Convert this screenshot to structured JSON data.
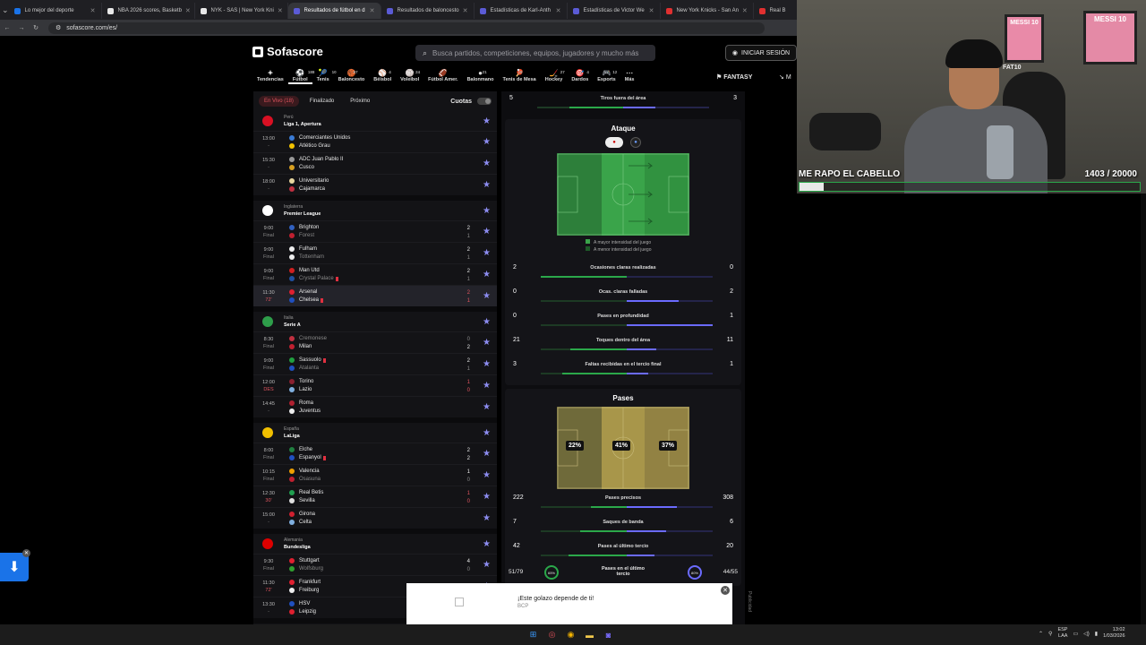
{
  "browser": {
    "tabs": [
      {
        "title": "Lo mejor del deporte",
        "color": "#1a73e8",
        "active": false
      },
      {
        "title": "NBA 2026 scores, Basketb",
        "color": "#e8e8e8",
        "active": false
      },
      {
        "title": "NYK - SAS | New York Kni",
        "color": "#e8e8e8",
        "active": false
      },
      {
        "title": "Resultados de fútbol en d",
        "color": "#5b5bd6",
        "active": true
      },
      {
        "title": "Resultados de baloncesto",
        "color": "#5b5bd6",
        "active": false
      },
      {
        "title": "Estadísticas de Karl-Anth",
        "color": "#5b5bd6",
        "active": false
      },
      {
        "title": "Estadísticas de Victor We",
        "color": "#5b5bd6",
        "active": false
      },
      {
        "title": "New York Knicks - San An",
        "color": "#e03030",
        "active": false
      },
      {
        "title": "Real B",
        "color": "#e03030",
        "active": false
      }
    ],
    "url": "sofascore.com/es/"
  },
  "header": {
    "logo": "Sofascore",
    "search_placeholder": "Busca partidos, competiciones, equipos, jugadores y mucho más",
    "login": "INICIAR SESIÓN",
    "fantasy": "FANTASY",
    "more_cut": "M"
  },
  "sports": [
    {
      "label": "Tendencias",
      "count": "",
      "icon": "✦",
      "active": false
    },
    {
      "label": "Fútbol",
      "count": "188",
      "icon": "⚽",
      "active": true
    },
    {
      "label": "Tenis",
      "count": "10",
      "icon": "🎾",
      "active": false
    },
    {
      "label": "Baloncesto",
      "count": "57",
      "icon": "🏀",
      "active": false
    },
    {
      "label": "Béisbol",
      "count": "4",
      "icon": "⚾",
      "active": false
    },
    {
      "label": "Voleibol",
      "count": "24",
      "icon": "🏐",
      "active": false
    },
    {
      "label": "Fútbol Amer.",
      "count": "",
      "icon": "🏈",
      "active": false
    },
    {
      "label": "Balonmano",
      "count": "21",
      "icon": "●",
      "active": false
    },
    {
      "label": "Tenis de Mesa",
      "count": "18",
      "icon": "🏓",
      "active": false
    },
    {
      "label": "Hockey",
      "count": "27",
      "icon": "🏒",
      "active": false
    },
    {
      "label": "Dardos",
      "count": "4",
      "icon": "🎯",
      "active": false
    },
    {
      "label": "Esports",
      "count": "12",
      "icon": "🎮",
      "active": false
    },
    {
      "label": "Más",
      "count": "",
      "icon": "⋯",
      "active": false
    }
  ],
  "filters": {
    "live": "En Vivo (18)",
    "finished": "Finalizado",
    "upcoming": "Próximo",
    "odds": "Cuotas"
  },
  "leagues": [
    {
      "country": "Perú",
      "name": "Liga 1, Apertura",
      "flag": "#d91023",
      "matches": [
        {
          "time": "13:00",
          "status": "-",
          "home": "Comerciantes Unidos",
          "away": "Atlético Grau",
          "hs": "",
          "as": "",
          "hc": "#3a7bd5",
          "ac": "#f2c200",
          "win": "",
          "sel": false,
          "live": false
        },
        {
          "time": "15:30",
          "status": "-",
          "home": "ADC Juan Pablo II",
          "away": "Cusco",
          "hs": "",
          "as": "",
          "hc": "#999",
          "ac": "#d8a020",
          "win": "",
          "sel": false,
          "live": false
        },
        {
          "time": "18:00",
          "status": "-",
          "home": "Universitario",
          "away": "Cajamarca",
          "hs": "",
          "as": "",
          "hc": "#e8d7a0",
          "ac": "#c03040",
          "win": "",
          "sel": false,
          "live": false
        }
      ]
    },
    {
      "country": "Inglaterra",
      "name": "Premier League",
      "flag": "#ffffff",
      "matches": [
        {
          "time": "9:00",
          "status": "Final",
          "home": "Brighton",
          "away": "Forest",
          "hs": "2",
          "as": "1",
          "hc": "#3060c0",
          "ac": "#c02030",
          "win": "home",
          "sel": false,
          "live": false
        },
        {
          "time": "9:00",
          "status": "Final",
          "home": "Fulham",
          "away": "Tottenham",
          "hs": "2",
          "as": "1",
          "hc": "#eee",
          "ac": "#eee",
          "win": "home",
          "sel": false,
          "live": false
        },
        {
          "time": "9:00",
          "status": "Final",
          "home": "Man Utd",
          "away": "Crystal Palace",
          "hs": "2",
          "as": "1",
          "hc": "#d02020",
          "ac": "#2050a0",
          "win": "home",
          "sel": false,
          "live": false,
          "away_red": true
        },
        {
          "time": "11:30",
          "status": "72'",
          "home": "Arsenal",
          "away": "Chelsea",
          "hs": "2",
          "as": "1",
          "hc": "#e02030",
          "ac": "#2050c0",
          "win": "",
          "sel": true,
          "live": true,
          "away_red": true
        }
      ]
    },
    {
      "country": "Italia",
      "name": "Serie A",
      "flag": "#2e9e4a",
      "matches": [
        {
          "time": "8:30",
          "status": "Final",
          "home": "Cremonese",
          "away": "Milan",
          "hs": "0",
          "as": "2",
          "hc": "#c03040",
          "ac": "#c02030",
          "win": "away",
          "sel": false,
          "live": false
        },
        {
          "time": "9:00",
          "status": "Final",
          "home": "Sassuolo",
          "away": "Atalanta",
          "hs": "2",
          "as": "1",
          "hc": "#20a040",
          "ac": "#2050c0",
          "win": "home",
          "sel": false,
          "live": false,
          "home_red": true
        },
        {
          "time": "12:00",
          "status": "DES",
          "home": "Torino",
          "away": "Lazio",
          "hs": "1",
          "as": "0",
          "hc": "#8a2030",
          "ac": "#80b0e0",
          "win": "",
          "sel": false,
          "live": true
        },
        {
          "time": "14:45",
          "status": "-",
          "home": "Roma",
          "away": "Juventus",
          "hs": "",
          "as": "",
          "hc": "#b02030",
          "ac": "#eee",
          "win": "",
          "sel": false,
          "live": false
        }
      ]
    },
    {
      "country": "España",
      "name": "LaLiga",
      "flag": "#f1bf00",
      "matches": [
        {
          "time": "8:00",
          "status": "Final",
          "home": "Elche",
          "away": "Espanyol",
          "hs": "2",
          "as": "2",
          "hc": "#208040",
          "ac": "#2050c0",
          "win": "",
          "sel": false,
          "live": false,
          "away_red": true
        },
        {
          "time": "10:15",
          "status": "Final",
          "home": "Valencia",
          "away": "Osasuna",
          "hs": "1",
          "as": "0",
          "hc": "#f0a000",
          "ac": "#c02030",
          "win": "home",
          "sel": false,
          "live": false
        },
        {
          "time": "12:30",
          "status": "30'",
          "home": "Real Betis",
          "away": "Sevilla",
          "hs": "1",
          "as": "0",
          "hc": "#20a050",
          "ac": "#e0e0e0",
          "win": "",
          "sel": false,
          "live": true
        },
        {
          "time": "15:00",
          "status": "-",
          "home": "Girona",
          "away": "Celta",
          "hs": "",
          "as": "",
          "hc": "#d02030",
          "ac": "#80b0e0",
          "win": "",
          "sel": false,
          "live": false
        }
      ]
    },
    {
      "country": "Alemania",
      "name": "Bundesliga",
      "flag": "#dd0000",
      "matches": [
        {
          "time": "9:30",
          "status": "Final",
          "home": "Stuttgart",
          "away": "Wolfsburg",
          "hs": "4",
          "as": "0",
          "hc": "#e02030",
          "ac": "#30a030",
          "win": "home",
          "sel": false,
          "live": false
        },
        {
          "time": "11:30",
          "status": "72'",
          "home": "Frankfurt",
          "away": "Freiburg",
          "hs": "",
          "as": "",
          "hc": "#e02030",
          "ac": "#eee",
          "win": "",
          "sel": false,
          "live": true
        },
        {
          "time": "13:30",
          "status": "-",
          "home": "HSV",
          "away": "Leipzig",
          "hs": "",
          "as": "",
          "hc": "#2050c0",
          "ac": "#e02030",
          "win": "",
          "sel": false,
          "live": false
        }
      ]
    }
  ],
  "stats_top": [
    {
      "label": "Tiros fuera del área",
      "home": "5",
      "away": "3",
      "h": 0.62,
      "a": 0.38
    }
  ],
  "attack": {
    "title": "Ataque",
    "legend_high": "A mayor intensidad del juego",
    "legend_low": "A menor intensidad del juego",
    "stats": [
      {
        "label": "Ocasiones claras realizadas",
        "home": "2",
        "away": "0",
        "h": 1.0,
        "a": 0.0
      },
      {
        "label": "Ocas. claras falladas",
        "home": "0",
        "away": "2",
        "h": 0.0,
        "a": 0.6
      },
      {
        "label": "Pases en profundidad",
        "home": "0",
        "away": "1",
        "h": 0.0,
        "a": 1.0
      },
      {
        "label": "Toques dentro del área",
        "home": "21",
        "away": "11",
        "h": 0.66,
        "a": 0.34
      },
      {
        "label": "Faltas recibidas en el tercio final",
        "home": "3",
        "away": "1",
        "h": 0.75,
        "a": 0.25
      }
    ]
  },
  "passes": {
    "title": "Pases",
    "zones": [
      "22%",
      "41%",
      "37%"
    ],
    "stats": [
      {
        "label": "Pases precisos",
        "home": "222",
        "away": "308",
        "h": 0.42,
        "a": 0.58
      },
      {
        "label": "Saques de banda",
        "home": "7",
        "away": "6",
        "h": 0.54,
        "a": 0.46
      },
      {
        "label": "Pases al último tercio",
        "home": "42",
        "away": "20",
        "h": 0.68,
        "a": 0.32
      }
    ],
    "last_row": {
      "label": "Pases en el último tercio",
      "home": "51/79",
      "home_pct": "65%",
      "away": "44/55",
      "away_pct": "80%"
    }
  },
  "ad": {
    "title": "¡Este golazo depende de ti!",
    "sponsor": "BCP",
    "side": "Publicidad"
  },
  "webcam": {
    "goal_label": "ME RAPO EL CABELLO",
    "goal_count": "1403  / 20000",
    "goal_progress": 0.07,
    "poster1": "MESSI 10",
    "poster2": "MESSI 10",
    "shirt": "FAT10"
  },
  "taskbar": {
    "lang1": "ESP",
    "lang2": "LAA",
    "time": "13:02",
    "date": "1/03/2026"
  }
}
